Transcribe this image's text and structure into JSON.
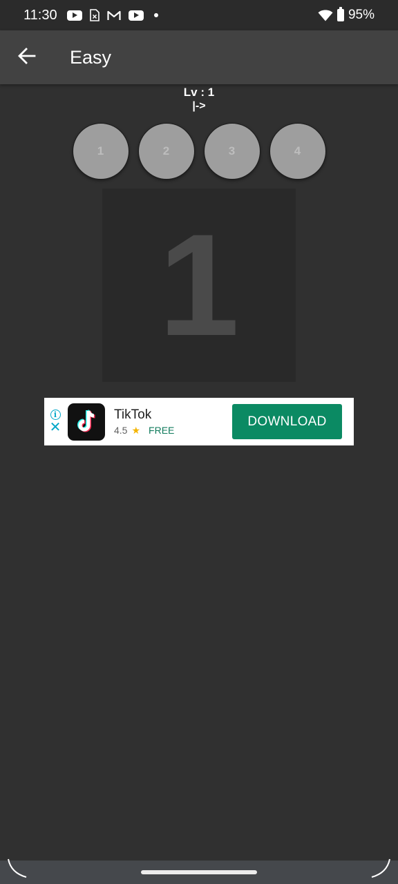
{
  "status_bar": {
    "time": "11:30",
    "icons": [
      "youtube-icon",
      "sim-icon",
      "gmail-icon",
      "youtube-icon",
      "dot-icon"
    ],
    "wifi_icon": "wifi-icon",
    "battery_icon": "battery-icon",
    "battery_percent": "95%"
  },
  "app_bar": {
    "back_icon": "arrow-back-icon",
    "title": "Easy"
  },
  "level": {
    "label": "Lv : 1",
    "arrow": "|->"
  },
  "circles": [
    "1",
    "2",
    "3",
    "4"
  ],
  "number_panel": {
    "value": "1"
  },
  "ad": {
    "info_icon": "info-icon",
    "close_icon": "close-icon",
    "app_icon": "tiktok-icon",
    "app_name": "TikTok",
    "rating": "4.5",
    "star_icon": "star-icon",
    "price": "FREE",
    "cta": "DOWNLOAD",
    "cta_color": "#0b8a63"
  },
  "colors": {
    "background": "#303030",
    "app_bar": "#424242",
    "circle": "#9e9e9e"
  }
}
